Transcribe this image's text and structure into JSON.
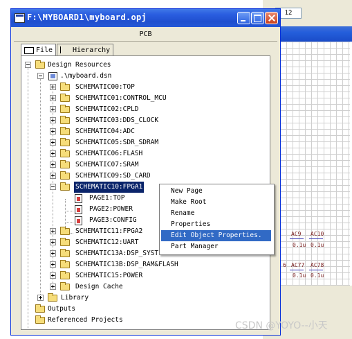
{
  "background_window": {
    "zoom_value": "12",
    "components": [
      {
        "ref": "AC9",
        "value": "0.1u"
      },
      {
        "ref": "AC10",
        "value": "0.1u"
      },
      {
        "ref": "AC77",
        "value": "0.1u"
      },
      {
        "ref": "AC78",
        "value": "0.1u"
      }
    ],
    "partial_digit": "6"
  },
  "window": {
    "title": "F:\\MYBOARD1\\myboard.opj",
    "panel_header": "PCB"
  },
  "tabs": [
    {
      "label": "File"
    },
    {
      "label": "Hierarchy"
    }
  ],
  "tree": {
    "design_resources": "Design Resources",
    "dsn": ".\\myboard.dsn",
    "schematics": [
      "SCHEMATIC00:TOP",
      "SCHEMATIC01:CONTROL_MCU",
      "SCHEMATIC02:CPLD",
      "SCHEMATIC03:DDS_CLOCK",
      "SCHEMATIC04:ADC",
      "SCHEMATIC05:SDR_SDRAM",
      "SCHEMATIC06:FLASH",
      "SCHEMATIC07:SRAM",
      "SCHEMATIC09:SD_CARD",
      "SCHEMATIC10:FPGA1"
    ],
    "pages": [
      "PAGE1:TOP",
      "PAGE2:POWER",
      "PAGE3:CONFIG"
    ],
    "schematics_after": [
      "SCHEMATIC11:FPGA2",
      "SCHEMATIC12:UART",
      "SCHEMATIC13A:DSP_SYSTEM",
      "SCHEMATIC13B:DSP_RAM&FLASH",
      "SCHEMATIC15:POWER"
    ],
    "design_cache": "Design Cache",
    "library": "Library",
    "outputs": "Outputs",
    "referenced_projects": "Referenced Projects"
  },
  "context_menu": {
    "items": [
      "New Page",
      "Make Root",
      "Rename",
      "Properties",
      "Edit Object Properties.",
      "Part Manager"
    ],
    "highlighted": "Edit Object Properties."
  },
  "watermark": "CSDN @YOYO--小天"
}
